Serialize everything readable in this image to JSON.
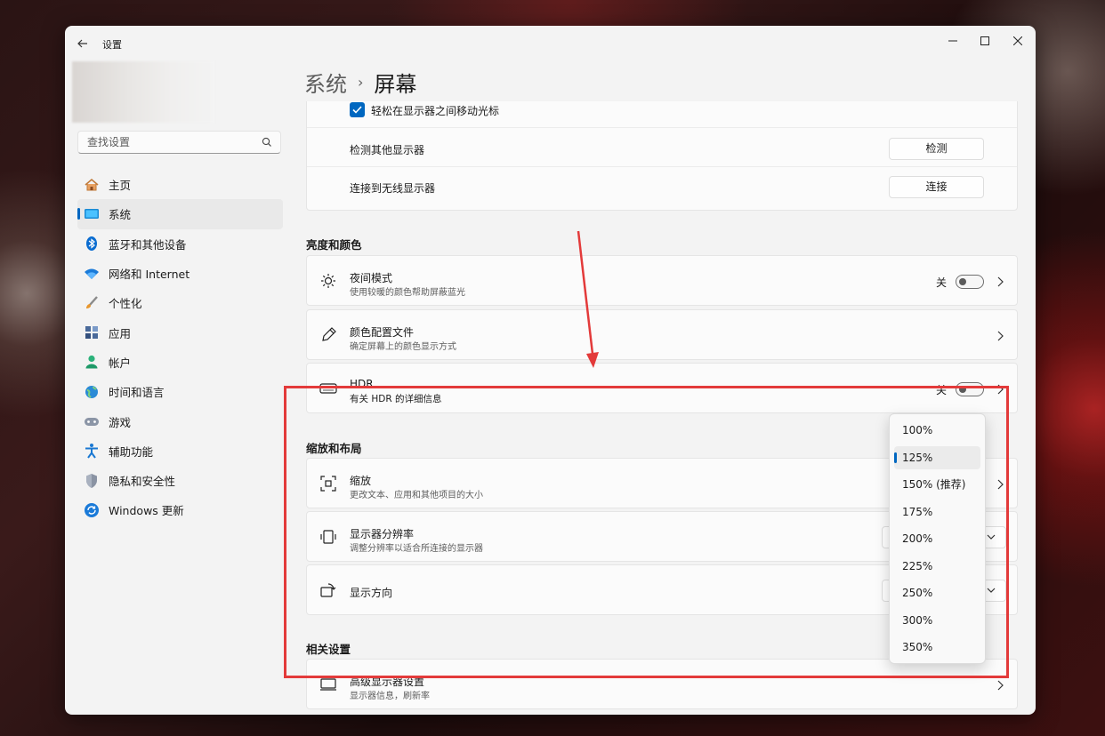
{
  "window": {
    "title": "设置"
  },
  "search": {
    "placeholder": "查找设置"
  },
  "sidebar": {
    "items": [
      {
        "label": "主页",
        "icon": "home-icon"
      },
      {
        "label": "系统",
        "icon": "system-icon",
        "active": true
      },
      {
        "label": "蓝牙和其他设备",
        "icon": "bluetooth-icon"
      },
      {
        "label": "网络和 Internet",
        "icon": "wifi-icon"
      },
      {
        "label": "个性化",
        "icon": "brush-icon"
      },
      {
        "label": "应用",
        "icon": "apps-icon"
      },
      {
        "label": "帐户",
        "icon": "account-icon"
      },
      {
        "label": "时间和语言",
        "icon": "globe-icon"
      },
      {
        "label": "游戏",
        "icon": "gamepad-icon"
      },
      {
        "label": "辅助功能",
        "icon": "accessibility-icon"
      },
      {
        "label": "隐私和安全性",
        "icon": "shield-icon"
      },
      {
        "label": "Windows 更新",
        "icon": "update-icon"
      }
    ]
  },
  "breadcrumb": {
    "parent": "系统",
    "separator": "›",
    "current": "屏幕"
  },
  "multi_display": {
    "checkbox_label": "轻松在显示器之间移动光标",
    "detect_label": "检测其他显示器",
    "detect_button": "检测",
    "wireless_label": "连接到无线显示器",
    "wireless_button": "连接"
  },
  "brightness_section": {
    "heading": "亮度和颜色",
    "night_mode": {
      "title": "夜间模式",
      "subtitle": "使用较暖的颜色帮助屏蔽蓝光",
      "state": "关"
    },
    "color_profile": {
      "title": "颜色配置文件",
      "subtitle": "确定屏幕上的颜色显示方式"
    },
    "hdr": {
      "title": "HDR",
      "subtitle": "有关 HDR 的详细信息",
      "state": "关"
    }
  },
  "scale_section": {
    "heading": "缩放和布局",
    "scale": {
      "title": "缩放",
      "subtitle": "更改文本、应用和其他项目的大小"
    },
    "resolution": {
      "title": "显示器分辨率",
      "subtitle": "调整分辨率以适合所连接的显示器"
    },
    "orientation": {
      "title": "显示方向"
    }
  },
  "related_section": {
    "heading": "相关设置",
    "advanced": {
      "title": "高级显示器设置",
      "subtitle": "显示器信息，刷新率"
    }
  },
  "scale_dropdown": {
    "options": [
      "100%",
      "125%",
      "150% (推荐)",
      "175%",
      "200%",
      "225%",
      "250%",
      "300%",
      "350%"
    ],
    "selected": "125%"
  },
  "colors": {
    "accent": "#0067c0",
    "annotation": "#e33a3a"
  }
}
